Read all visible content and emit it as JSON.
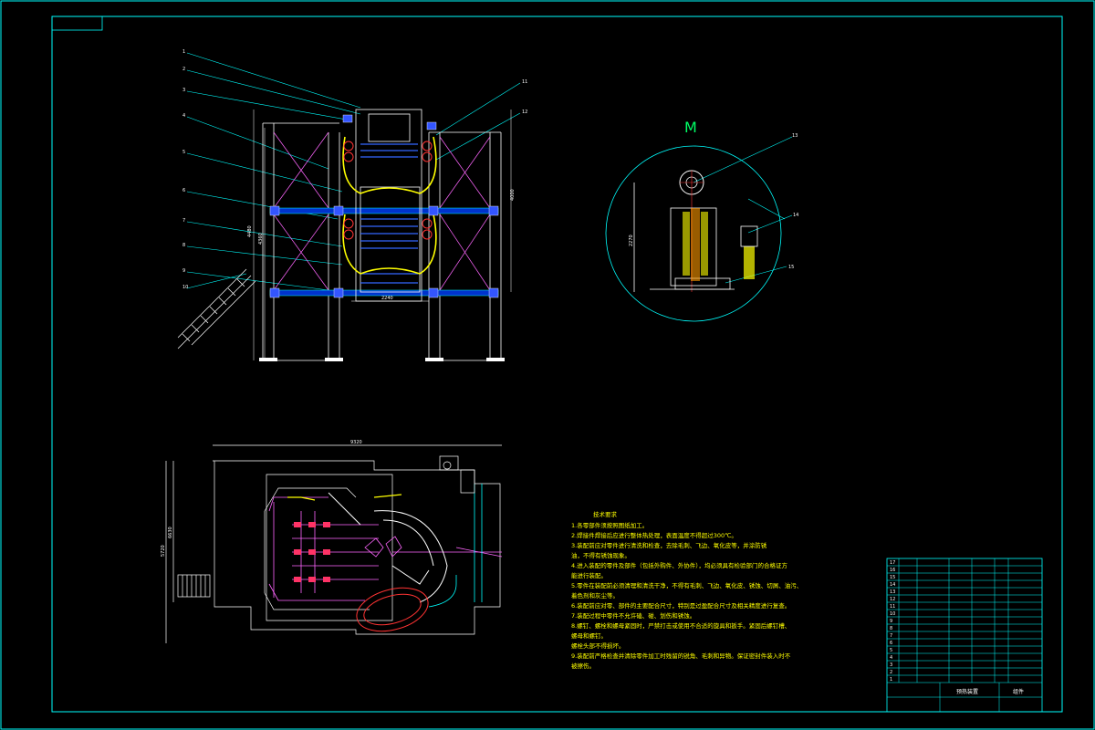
{
  "detail_view": {
    "label": "M"
  },
  "elevation_view": {
    "leaders": [
      "1",
      "2",
      "3",
      "4",
      "5",
      "6",
      "7",
      "8",
      "9",
      "10"
    ],
    "right_leaders": [
      "11",
      "12"
    ],
    "dim_bottom": "2240",
    "dim_right": "4000",
    "dim_left_a": "4480",
    "dim_left_b": "4360"
  },
  "detail_leaders": [
    "13",
    "14",
    "15"
  ],
  "detail_dim": "2270",
  "plan_view": {
    "dim_top": "9320",
    "dim_left_a": "5720",
    "dim_left_b": "6630"
  },
  "technical_notes": {
    "title": "技术要求",
    "lines": [
      "1.各零部件须按照图纸加工。",
      "2.焊接件焊接后应进行整体热处理，表面温度不得超过300℃。",
      "3.装配前应对零件进行清洗和检查，去除毛刺、飞边、氧化皮等，并涂防锈",
      "  油，不得有锈蚀现象。",
      "4.进入装配的零件及部件（包括外购件、外协件），均必须具有检验部门的合格证方",
      "  能进行装配。",
      "5.零件在装配前必须清理和清洗干净，不得有毛刺、飞边、氧化皮、锈蚀、切屑、油污、",
      "  着色剂和灰尘等。",
      "6.装配前应对零、部件的主要配合尺寸，特别是过盈配合尺寸及相关精度进行复查。",
      "7.装配过程中零件不允许磕、碰、划伤和锈蚀。",
      "8.螺钉、螺栓和螺母紧固时，严禁打击或使用不合适的旋具和扳手。紧固后螺钉槽、",
      "  螺母和螺钉。",
      "  螺栓头部不得损坏。",
      "9.装配前严格检查并清除零件加工时残留的锐角、毛刺和异物。保证密封件装入时不",
      "  被擦伤。"
    ]
  },
  "title_block": {
    "name": "预热装置",
    "type": "组件",
    "row_labels": [
      "1",
      "2",
      "3",
      "4",
      "5",
      "6",
      "7",
      "8",
      "9",
      "10",
      "11",
      "12",
      "13",
      "14",
      "15",
      "16",
      "17"
    ]
  }
}
